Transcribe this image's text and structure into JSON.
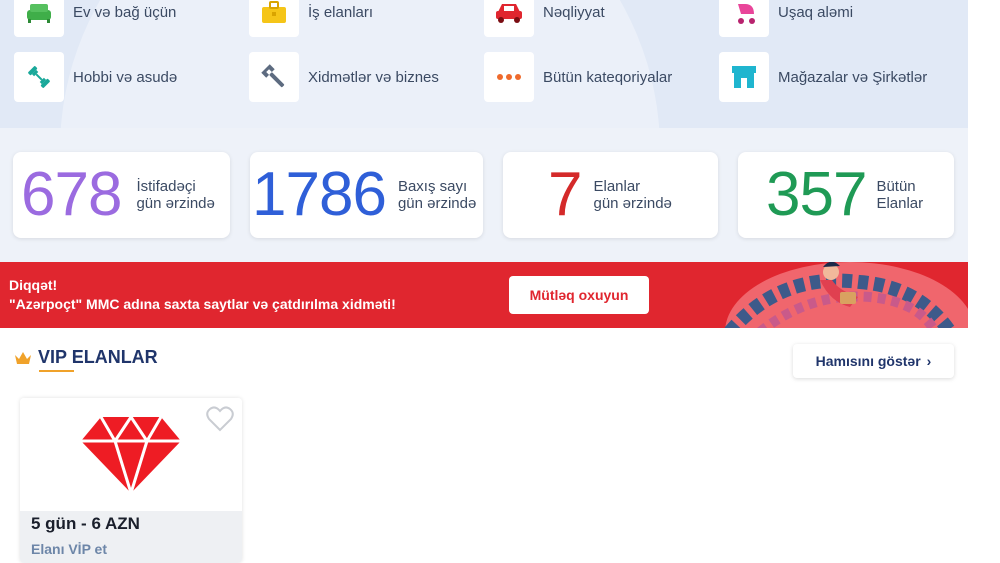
{
  "categories": [
    {
      "label": "Ev və bağ üçün",
      "icon": "sofa-icon"
    },
    {
      "label": "İş elanları",
      "icon": "briefcase-icon"
    },
    {
      "label": "Nəqliyyat",
      "icon": "car-icon"
    },
    {
      "label": "Uşaq aləmi",
      "icon": "stroller-icon"
    },
    {
      "label": "Hobbi və asudə",
      "icon": "dumbbell-icon"
    },
    {
      "label": "Xidmətlər və biznes",
      "icon": "wrench-icon"
    },
    {
      "label": "Bütün kateqoriyalar",
      "icon": "dots-icon"
    },
    {
      "label": "Mağazalar və Şirkətlər",
      "icon": "store-icon"
    }
  ],
  "stats": [
    {
      "value": "678",
      "label": "İstifadəçi\ngün ərzində",
      "color": "#9b6be0"
    },
    {
      "value": "1786",
      "label": "Baxış sayı\ngün ərzində",
      "color": "#2f5fd8"
    },
    {
      "value": "7",
      "label": "Elanlar\ngün ərzində",
      "color": "#d42a2a"
    },
    {
      "value": "357",
      "label": "Bütün\nElanlar",
      "color": "#1f9a55"
    }
  ],
  "warning": {
    "title": "Diqqət!",
    "text": "\"Azərpoçt\" MMC adına saxta saytlar və çatdırılma xidməti!",
    "button": "Mütləq oxuyun",
    "color": "#e0262f"
  },
  "vip": {
    "title": "VIP ELANLAR",
    "show_all": "Hamısını göstər",
    "card": {
      "price": "5 gün - 6 AZN",
      "link": "Elanı VİP et"
    }
  },
  "colors": {
    "accent": "#f0a22a",
    "brand_dark": "#20356b"
  }
}
